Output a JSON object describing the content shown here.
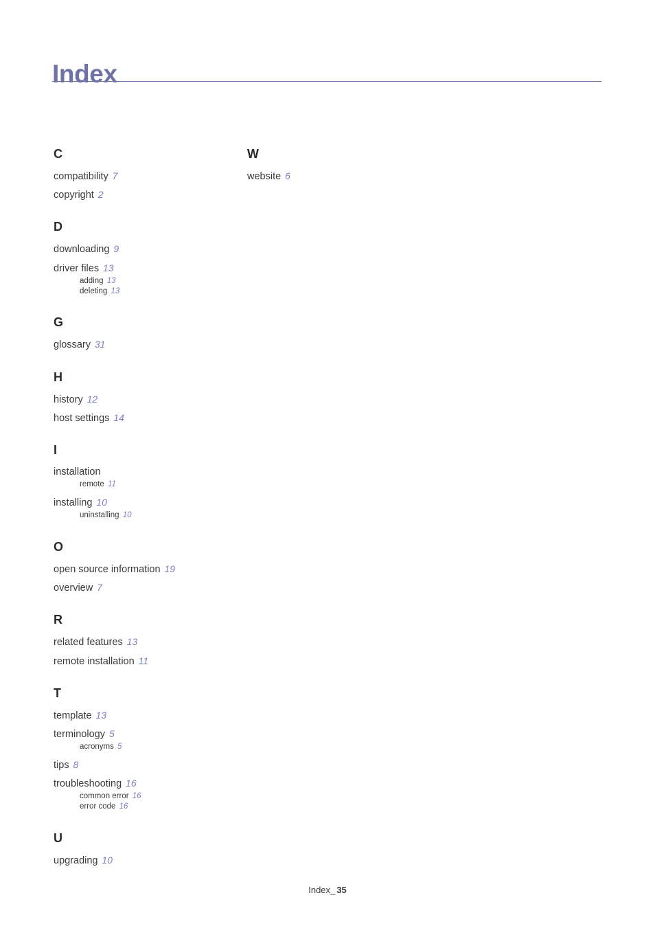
{
  "title": "Index",
  "footer": {
    "label": "Index_",
    "page_number": "35"
  },
  "colors": {
    "title": "#6f72a6",
    "rule": "#6f72a6",
    "page_number": "#7b7fc4",
    "text": "#3a3a3a",
    "section_letter": "#2b2b2b",
    "background": "#ffffff"
  },
  "columns": [
    {
      "sections": [
        {
          "letter": "C",
          "entries": [
            {
              "term": "compatibility",
              "page": "7",
              "subentries": []
            },
            {
              "term": "copyright",
              "page": "2",
              "subentries": []
            }
          ]
        },
        {
          "letter": "D",
          "entries": [
            {
              "term": "downloading",
              "page": "9",
              "subentries": []
            },
            {
              "term": "driver files",
              "page": "13",
              "subentries": [
                {
                  "term": "adding",
                  "page": "13"
                },
                {
                  "term": "deleting",
                  "page": "13"
                }
              ]
            }
          ]
        },
        {
          "letter": "G",
          "entries": [
            {
              "term": "glossary",
              "page": "31",
              "subentries": []
            }
          ]
        },
        {
          "letter": "H",
          "entries": [
            {
              "term": "history",
              "page": "12",
              "subentries": []
            },
            {
              "term": "host settings",
              "page": "14",
              "subentries": []
            }
          ]
        },
        {
          "letter": "I",
          "entries": [
            {
              "term": "installation",
              "page": "",
              "subentries": [
                {
                  "term": "remote",
                  "page": "11"
                }
              ]
            },
            {
              "term": "installing",
              "page": "10",
              "subentries": [
                {
                  "term": "uninstalling",
                  "page": "10"
                }
              ]
            }
          ]
        },
        {
          "letter": "O",
          "entries": [
            {
              "term": "open source information",
              "page": "19",
              "subentries": []
            },
            {
              "term": "overview",
              "page": "7",
              "subentries": []
            }
          ]
        },
        {
          "letter": "R",
          "entries": [
            {
              "term": "related features",
              "page": "13",
              "subentries": []
            },
            {
              "term": "remote installation",
              "page": "11",
              "subentries": []
            }
          ]
        },
        {
          "letter": "T",
          "entries": [
            {
              "term": "template",
              "page": "13",
              "subentries": []
            },
            {
              "term": "terminology",
              "page": "5",
              "subentries": [
                {
                  "term": "acronyms",
                  "page": "5"
                }
              ]
            },
            {
              "term": "tips",
              "page": "8",
              "subentries": []
            },
            {
              "term": "troubleshooting",
              "page": "16",
              "subentries": [
                {
                  "term": "common error",
                  "page": "16"
                },
                {
                  "term": "error code",
                  "page": "16"
                }
              ]
            }
          ]
        },
        {
          "letter": "U",
          "entries": [
            {
              "term": "upgrading",
              "page": "10",
              "subentries": []
            }
          ]
        }
      ]
    },
    {
      "sections": [
        {
          "letter": "W",
          "entries": [
            {
              "term": "website",
              "page": "6",
              "subentries": []
            }
          ]
        }
      ]
    }
  ]
}
